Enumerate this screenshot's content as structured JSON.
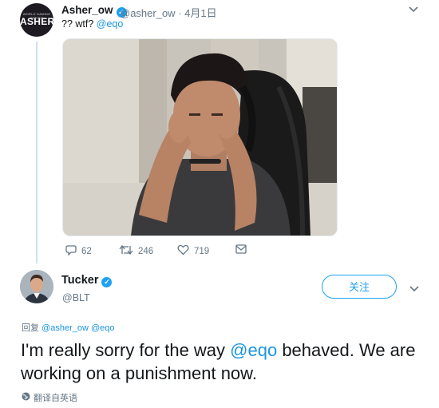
{
  "quoted_tweet": {
    "avatar_text_small": "WORLD GAMING SERIES",
    "avatar_text_big": "ASHER",
    "display_name": "Asher_ow",
    "handle": "@asher_ow",
    "separator": "·",
    "date": "4月1日",
    "text_prefix": "?? wtf? ",
    "text_mention": "@eqo",
    "actions": {
      "replies": "62",
      "retweets": "246",
      "likes": "719"
    }
  },
  "reply_tweet": {
    "display_name": "Tucker",
    "handle": "@BLT",
    "follow_label": "关注",
    "reply_prefix": "回复",
    "reply_to": "@asher_ow @eqo",
    "text_part1": "I'm really sorry for the way ",
    "text_mention": "@eqo",
    "text_part2": " behaved. We are working on a punishment now.",
    "translate_label": "翻译自英语"
  },
  "colors": {
    "accent": "#1da1f2",
    "mention": "#1b95e0",
    "muted": "#657786",
    "text": "#14171a"
  },
  "icons": [
    "reply-icon",
    "retweet-icon",
    "like-icon",
    "message-icon",
    "chevron-down-icon",
    "verified-badge-icon",
    "globe-icon"
  ]
}
